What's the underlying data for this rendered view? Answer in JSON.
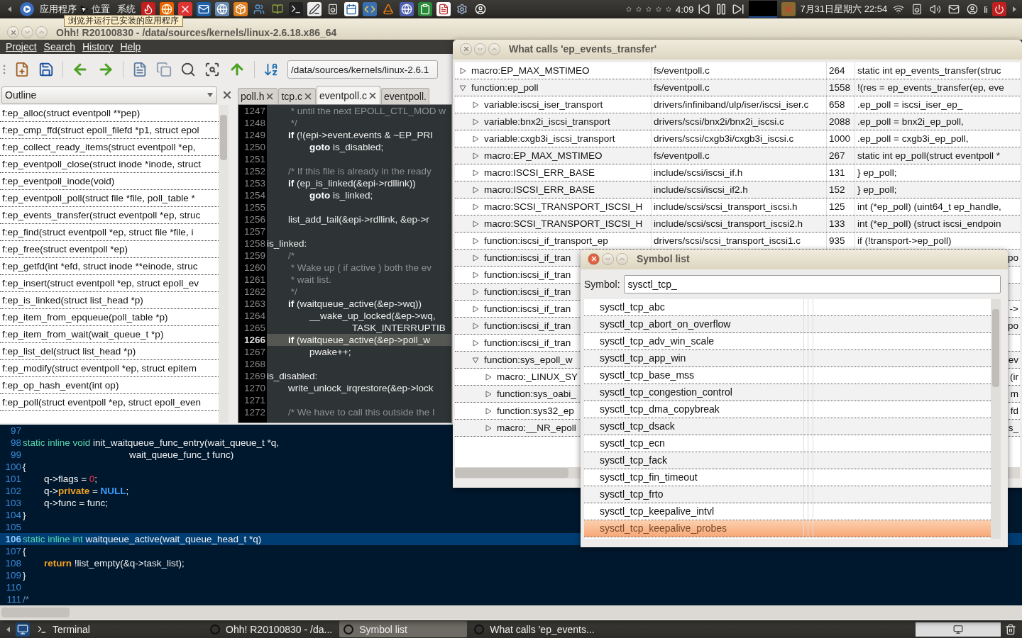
{
  "top_panel": {
    "menus": [
      "应用程序",
      "位置",
      "系统"
    ],
    "tooltip": "浏览并运行已安装的应用程序",
    "player": {
      "stars": 0,
      "time": "4:09"
    },
    "datetime": "7月31日星期六 22:54",
    "user": "li"
  },
  "main_window": {
    "title": "Ohh! R20100830 - /data/sources/kernels/linux-2.6.18.x86_64",
    "menu": [
      "Project",
      "Search",
      "History",
      "Help"
    ],
    "path": "/data/sources/kernels/linux-2.6.1",
    "outline": {
      "selector": "Outline",
      "items": [
        "f:ep_alloc(struct eventpoll **pep)",
        "f:ep_cmp_ffd(struct epoll_filefd *p1, struct epol",
        "f:ep_collect_ready_items(struct eventpoll *ep,",
        "f:ep_eventpoll_close(struct inode *inode, struct",
        "f:ep_eventpoll_inode(void)",
        "f:ep_eventpoll_poll(struct file *file, poll_table *",
        "f:ep_events_transfer(struct eventpoll *ep, struc",
        "f:ep_find(struct eventpoll *ep, struct file *file, i",
        "f:ep_free(struct eventpoll *ep)",
        "f:ep_getfd(int *efd, struct inode **einode, struc",
        "f:ep_insert(struct eventpoll *ep, struct epoll_ev",
        "f:ep_is_linked(struct list_head *p)",
        "f:ep_item_from_epqueue(poll_table *p)",
        "f:ep_item_from_wait(wait_queue_t *p)",
        "f:ep_list_del(struct list_head *p)",
        "f:ep_modify(struct eventpoll *ep, struct epitem",
        "f:ep_op_hash_event(int op)",
        "f:ep_poll(struct eventpoll *ep, struct epoll_even"
      ]
    },
    "tabs": [
      {
        "label": "poll.h",
        "selected": false
      },
      {
        "label": "tcp.c",
        "selected": false
      },
      {
        "label": "eventpoll.c",
        "selected": true
      },
      {
        "label": "eventpoll.",
        "selected": false
      }
    ],
    "editor": [
      {
        "number": "1247",
        "current": false,
        "segments": [
          {
            "kind": "comment",
            "text": "\t * until the next EPOLL_CTL_MOD w"
          }
        ]
      },
      {
        "number": "1248",
        "current": false,
        "segments": [
          {
            "kind": "comment",
            "text": "\t */"
          }
        ]
      },
      {
        "number": "1249",
        "current": false,
        "segments": [
          {
            "kind": "keyword",
            "text": "\tif"
          },
          {
            "kind": "plain",
            "text": " (!(epi->event.events & ~EP_PRI"
          }
        ]
      },
      {
        "number": "1250",
        "current": false,
        "segments": [
          {
            "kind": "keyword",
            "text": "\t\tgoto"
          },
          {
            "kind": "plain",
            "text": " is_disabled;"
          }
        ]
      },
      {
        "number": "1251",
        "current": false
      },
      {
        "number": "1252",
        "current": false,
        "segments": [
          {
            "kind": "comment",
            "text": "\t/* If this file is already in the ready"
          }
        ]
      },
      {
        "number": "1253",
        "current": false,
        "segments": [
          {
            "kind": "keyword",
            "text": "\tif"
          },
          {
            "kind": "plain",
            "text": " (ep_is_linked(&epi->rdllink))"
          }
        ]
      },
      {
        "number": "1254",
        "current": false,
        "segments": [
          {
            "kind": "keyword",
            "text": "\t\tgoto"
          },
          {
            "kind": "plain",
            "text": " is_linked;"
          }
        ]
      },
      {
        "number": "1255",
        "current": false
      },
      {
        "number": "1256",
        "current": false,
        "segments": [
          {
            "kind": "plain",
            "text": "\tlist_add_tail(&epi->rdllink, &ep->r"
          }
        ]
      },
      {
        "number": "1257",
        "current": false
      },
      {
        "number": "1258",
        "current": false,
        "segments": [
          {
            "kind": "plain",
            "text": "is_linked:"
          }
        ]
      },
      {
        "number": "1259",
        "current": false,
        "segments": [
          {
            "kind": "comment",
            "text": "\t/*"
          }
        ]
      },
      {
        "number": "1260",
        "current": false,
        "segments": [
          {
            "kind": "comment",
            "text": "\t * Wake up ( if active ) both the ev"
          }
        ]
      },
      {
        "number": "1261",
        "current": false,
        "segments": [
          {
            "kind": "comment",
            "text": "\t * wait list."
          }
        ]
      },
      {
        "number": "1262",
        "current": false,
        "segments": [
          {
            "kind": "comment",
            "text": "\t */"
          }
        ]
      },
      {
        "number": "1263",
        "current": false,
        "segments": [
          {
            "kind": "keyword",
            "text": "\tif"
          },
          {
            "kind": "plain",
            "text": " (waitqueue_active(&ep->wq))"
          }
        ]
      },
      {
        "number": "1264",
        "current": false,
        "segments": [
          {
            "kind": "plain",
            "text": "\t\t__wake_up_locked(&ep->wq,"
          }
        ]
      },
      {
        "number": "1265",
        "current": false,
        "segments": [
          {
            "kind": "plain",
            "text": "\t\t\t\tTASK_INTERRUPTIB"
          }
        ]
      },
      {
        "number": "1266",
        "current": true,
        "segments": [
          {
            "kind": "keyword",
            "text": "\tif"
          },
          {
            "kind": "plain",
            "text": " (waitqueue_active(&ep->poll_w"
          }
        ]
      },
      {
        "number": "1267",
        "current": false,
        "segments": [
          {
            "kind": "plain",
            "text": "\t\tpwake++;"
          }
        ]
      },
      {
        "number": "1268",
        "current": false
      },
      {
        "number": "1269",
        "current": false,
        "segments": [
          {
            "kind": "plain",
            "text": "is_disabled:"
          }
        ]
      },
      {
        "number": "1270",
        "current": false,
        "segments": [
          {
            "kind": "plain",
            "text": "\twrite_unlock_irqrestore(&ep->lock"
          }
        ]
      },
      {
        "number": "1271",
        "current": false
      },
      {
        "number": "1272",
        "current": false,
        "segments": [
          {
            "kind": "comment",
            "text": "\t/* We have to call this outside the l"
          }
        ]
      }
    ],
    "preview": [
      {
        "number": "97",
        "current": false
      },
      {
        "number": "98",
        "current": false,
        "segments": [
          {
            "kind": "type",
            "text": "static inline void"
          },
          {
            "kind": "plain",
            "text": " init_waitqueue_func_entry(wait_queue_t *q,"
          }
        ]
      },
      {
        "number": "99",
        "current": false,
        "segments": [
          {
            "kind": "plain",
            "text": "\t\t\t\t\twait_queue_func_t func)"
          }
        ]
      },
      {
        "number": "100",
        "current": false,
        "segments": [
          {
            "kind": "plain",
            "text": "{"
          }
        ]
      },
      {
        "number": "101",
        "current": false,
        "segments": [
          {
            "kind": "plain",
            "text": "\tq->flags = "
          },
          {
            "kind": "number",
            "text": "0"
          },
          {
            "kind": "plain",
            "text": ";"
          }
        ]
      },
      {
        "number": "102",
        "current": false,
        "segments": [
          {
            "kind": "plain",
            "text": "\tq->"
          },
          {
            "kind": "keyword",
            "text": "private"
          },
          {
            "kind": "plain",
            "text": " = "
          },
          {
            "kind": "constant",
            "text": "NULL"
          },
          {
            "kind": "plain",
            "text": ";"
          }
        ]
      },
      {
        "number": "103",
        "current": false,
        "segments": [
          {
            "kind": "plain",
            "text": "\tq->func = func;"
          }
        ]
      },
      {
        "number": "104",
        "current": false,
        "segments": [
          {
            "kind": "plain",
            "text": "}"
          }
        ]
      },
      {
        "number": "105",
        "current": false
      },
      {
        "number": "106",
        "current": true,
        "segments": [
          {
            "kind": "type",
            "text": "static inline int"
          },
          {
            "kind": "plain",
            "text": " waitqueue_active(wait_queue_head_t *q)"
          }
        ]
      },
      {
        "number": "107",
        "current": false,
        "segments": [
          {
            "kind": "plain",
            "text": "{"
          }
        ]
      },
      {
        "number": "108",
        "current": false,
        "segments": [
          {
            "kind": "keyword",
            "text": "\treturn"
          },
          {
            "kind": "plain",
            "text": " !list_empty(&q->task_list);"
          }
        ]
      },
      {
        "number": "109",
        "current": false,
        "segments": [
          {
            "kind": "plain",
            "text": "}"
          }
        ]
      },
      {
        "number": "110",
        "current": false
      },
      {
        "number": "111",
        "current": false,
        "segments": [
          {
            "kind": "comment",
            "text": "/*"
          }
        ]
      }
    ]
  },
  "calls_window": {
    "title": "What calls 'ep_events_transfer'",
    "rows": [
      {
        "name": "macro:EP_MAX_MSTIMEO",
        "file": "fs/eventpoll.c",
        "line": "264",
        "text": "static int ep_events_transfer(struc",
        "expanded": false
      },
      {
        "name": "function:ep_poll",
        "file": "fs/eventpoll.c",
        "line": "1558",
        "text": "!(res = ep_events_transfer(ep, eve",
        "expanded": true,
        "children": [
          {
            "name": "variable:iscsi_iser_transport",
            "file": "drivers/infiniband/ulp/iser/iscsi_iser.c",
            "line": "658",
            "text": ".ep_poll              = iscsi_iser_ep_",
            "expanded": false
          },
          {
            "name": "variable:bnx2i_iscsi_transport",
            "file": "drivers/scsi/bnx2i/bnx2i_iscsi.c",
            "line": "2088",
            "text": ".ep_poll          = bnx2i_ep_poll,",
            "expanded": false
          },
          {
            "name": "variable:cxgb3i_iscsi_transport",
            "file": "drivers/scsi/cxgb3i/cxgb3i_iscsi.c",
            "line": "1000",
            "text": ".ep_poll          = cxgb3i_ep_poll,",
            "expanded": false
          },
          {
            "name": "macro:EP_MAX_MSTIMEO",
            "file": "fs/eventpoll.c",
            "line": "267",
            "text": "static int ep_poll(struct eventpoll *",
            "expanded": false
          },
          {
            "name": "macro:ISCSI_ERR_BASE",
            "file": "include/scsi/iscsi_if.h",
            "line": "131",
            "text": "} ep_poll;",
            "expanded": false
          },
          {
            "name": "macro:ISCSI_ERR_BASE",
            "file": "include/scsi/iscsi_if2.h",
            "line": "152",
            "text": "} ep_poll;",
            "expanded": false
          },
          {
            "name": "macro:SCSI_TRANSPORT_ISCSI_H",
            "file": "include/scsi/scsi_transport_iscsi.h",
            "line": "125",
            "text": "int (*ep_poll) (uint64_t ep_handle,",
            "expanded": false
          },
          {
            "name": "macro:SCSI_TRANSPORT_ISCSI_H",
            "file": "include/scsi/scsi_transport_iscsi2.h",
            "line": "133",
            "text": "int (*ep_poll) (struct iscsi_endpoin",
            "expanded": false
          },
          {
            "name": "function:iscsi_if_transport_ep",
            "file": "drivers/scsi/scsi_transport_iscsi1.c",
            "line": "935",
            "text": "if (!transport->ep_poll)",
            "expanded": false
          },
          {
            "name": "function:iscsi_if_tran",
            "text": "po",
            "expanded": false
          },
          {
            "name": "function:iscsi_if_tran",
            "expanded": false
          },
          {
            "name": "function:iscsi_if_tran",
            "expanded": false
          },
          {
            "name": "function:iscsi_if_tran",
            "text": "->",
            "expanded": false
          },
          {
            "name": "function:iscsi_if_tran",
            "text": "po",
            "expanded": false
          },
          {
            "name": "function:iscsi_if_tran",
            "expanded": false
          },
          {
            "name": "function:sys_epoll_w",
            "text": "ev",
            "expanded": true,
            "children": [
              {
                "name": "macro:_LINUX_SY",
                "text": "(ir",
                "expanded": false
              },
              {
                "name": "function:sys_oabi_",
                "text": "m",
                "expanded": false
              },
              {
                "name": "function:sys32_ep",
                "text": "fd",
                "expanded": false
              },
              {
                "name": "macro:__NR_epoll",
                "text": "s_",
                "expanded": false
              }
            ]
          }
        ]
      }
    ]
  },
  "symbol_window": {
    "title": "Symbol list",
    "label": "Symbol:",
    "query": "sysctl_tcp_",
    "items": [
      {
        "name": "sysctl_tcp_abc",
        "selected": false
      },
      {
        "name": "sysctl_tcp_abort_on_overflow",
        "selected": false
      },
      {
        "name": "sysctl_tcp_adv_win_scale",
        "selected": false
      },
      {
        "name": "sysctl_tcp_app_win",
        "selected": false
      },
      {
        "name": "sysctl_tcp_base_mss",
        "selected": false
      },
      {
        "name": "sysctl_tcp_congestion_control",
        "selected": false
      },
      {
        "name": "sysctl_tcp_dma_copybreak",
        "selected": false
      },
      {
        "name": "sysctl_tcp_dsack",
        "selected": false
      },
      {
        "name": "sysctl_tcp_ecn",
        "selected": false
      },
      {
        "name": "sysctl_tcp_fack",
        "selected": false
      },
      {
        "name": "sysctl_tcp_fin_timeout",
        "selected": false
      },
      {
        "name": "sysctl_tcp_frto",
        "selected": false
      },
      {
        "name": "sysctl_tcp_keepalive_intvl",
        "selected": false
      },
      {
        "name": "sysctl_tcp_keepalive_probes",
        "selected": true
      }
    ]
  },
  "taskbar": [
    {
      "label": "Terminal",
      "kind": "terminal",
      "selected": false
    },
    {
      "label": "Ohh! R20100830 - /da...",
      "kind": "window",
      "selected": false
    },
    {
      "label": "Symbol list",
      "kind": "window",
      "selected": true
    },
    {
      "label": "What calls 'ep_events...",
      "kind": "window",
      "selected": false
    }
  ]
}
